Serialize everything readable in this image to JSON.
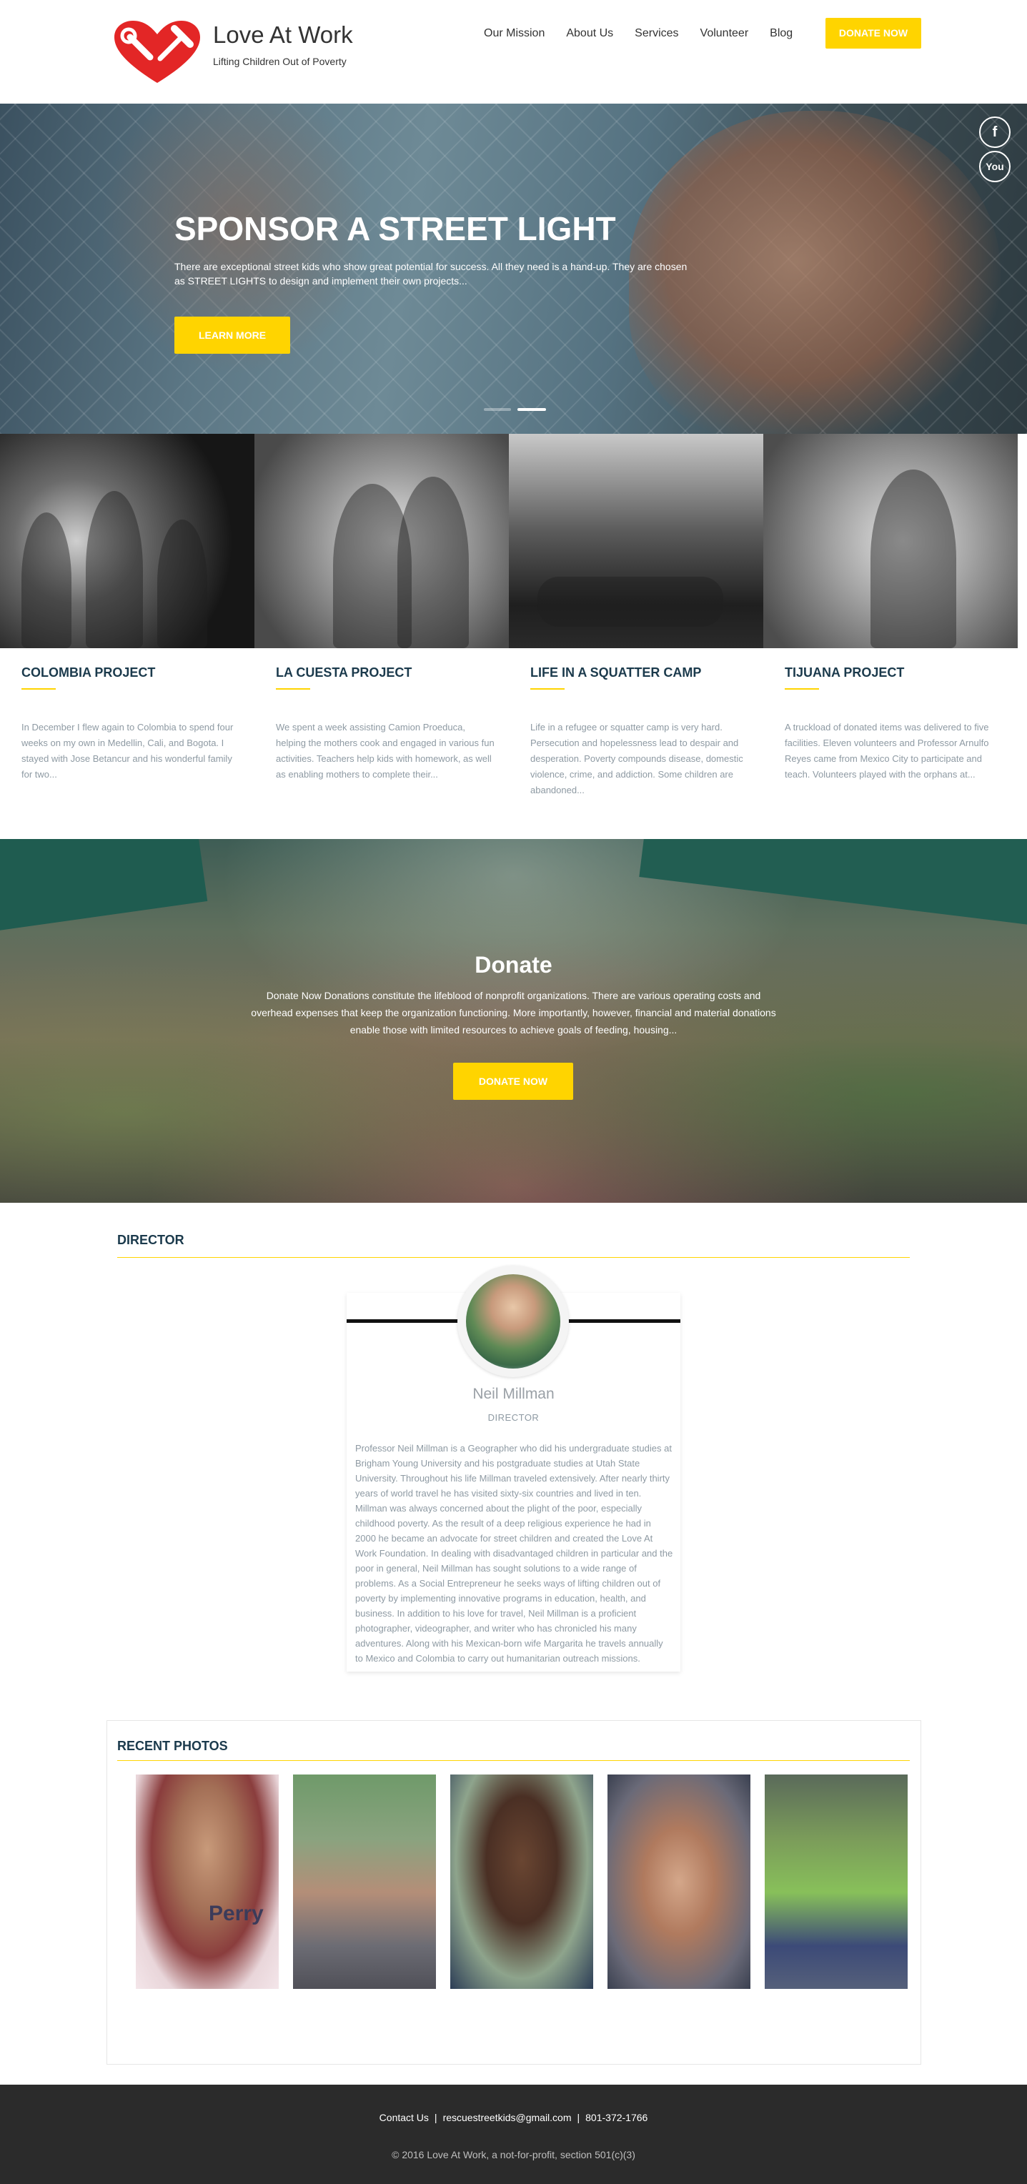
{
  "header": {
    "brand_title": "Love At Work",
    "brand_tagline": "Lifting Children Out of Poverty",
    "nav": [
      "Our Mission",
      "About Us",
      "Services",
      "Volunteer",
      "Blog"
    ],
    "donate_label": "DONATE NOW"
  },
  "hero": {
    "title": "SPONSOR A STREET LIGHT",
    "text": "There are exceptional street kids who show great potential for success. All they need is a hand-up. They are chosen as STREET LIGHTS to design and implement their own projects...",
    "button_label": "LEARN MORE",
    "social": [
      "f",
      "You"
    ]
  },
  "projects": [
    {
      "title": "COLOMBIA PROJECT",
      "text": "In December I flew again to Colombia to spend four weeks on my own in Medellin, Cali, and Bogota. I stayed with Jose Betancur and his wonderful family for two..."
    },
    {
      "title": "LA CUESTA PROJECT",
      "text": "We spent a week assisting Camion Proeduca, helping the mothers cook and engaged in various fun activities. Teachers help kids with homework, as well as enabling mothers to complete their..."
    },
    {
      "title": "LIFE IN A SQUATTER CAMP",
      "text": "Life in a refugee or squatter camp is very hard. Persecution and hopelessness lead to despair and desperation. Poverty compounds disease, domestic violence, crime, and addiction. Some children are abandoned..."
    },
    {
      "title": "TIJUANA PROJECT",
      "text": "A truckload of donated items was delivered to five facilities. Eleven volunteers and Professor Arnulfo Reyes came from Mexico City to participate and teach. Volunteers played with the orphans at..."
    }
  ],
  "donate": {
    "title": "Donate",
    "text": "Donate Now Donations constitute the lifeblood of nonprofit organizations. There are various operating costs and overhead expenses that keep the organization functioning. More importantly, however, financial and material donations enable those with limited resources to achieve goals of feeding, housing...",
    "button_label": "DONATE NOW"
  },
  "director": {
    "section_title": "DIRECTOR",
    "name": "Neil Millman",
    "role": "DIRECTOR",
    "bio": "Professor Neil Millman is a Geographer who did his undergraduate studies at Brigham Young University and his postgraduate studies at Utah State University. Throughout his life Millman traveled extensively. After nearly thirty years of world travel he has visited sixty-six countries and lived in ten. Millman was always concerned about the plight of the poor, especially childhood poverty. As the result of a deep religious experience he had in 2000 he became an advocate for street children and created the Love At Work Foundation. In dealing with disadvantaged children in particular and the poor in general, Neil Millman has sought solutions to a wide range of problems. As a Social Entrepreneur he seeks ways of lifting children out of poverty by implementing innovative programs in education, health, and business. In addition to his love for travel, Neil Millman is a proficient photographer, videographer, and writer who has chronicled his many adventures. Along with his Mexican-born wife Margarita he travels annually to Mexico and Colombia to carry out humanitarian outreach missions."
  },
  "recent_photos": {
    "section_title": "RECENT PHOTOS",
    "photo_text": "Perry"
  },
  "footer": {
    "contact": "Contact  Us",
    "email": "rescuestreetkids@gmail.com",
    "phone": "801-372-1766",
    "separator": "|",
    "copyright": "© 2016 Love At Work, a not-for-profit, section 501(c)(3)"
  },
  "colors": {
    "accent": "#ffd400",
    "heading": "#1b3a4c",
    "body_text": "#8e9aa3",
    "footer_bg": "#2b2b2b",
    "logo_red": "#e32626"
  }
}
